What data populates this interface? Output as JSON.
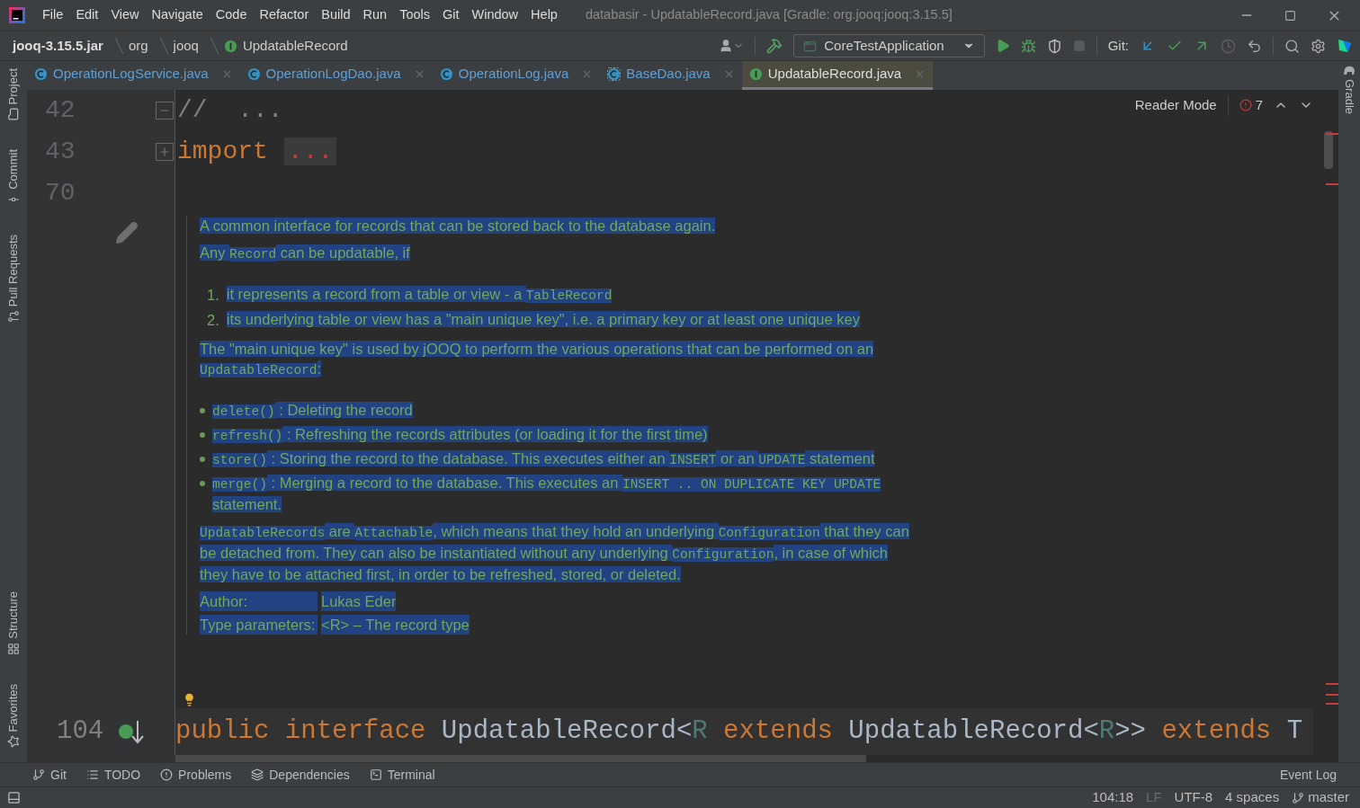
{
  "title_bar": {
    "menu": [
      "File",
      "Edit",
      "View",
      "Navigate",
      "Code",
      "Refactor",
      "Build",
      "Run",
      "Tools",
      "Git",
      "Window",
      "Help"
    ],
    "title": "databasir - UpdatableRecord.java [Gradle: org.jooq:jooq:3.15.5]"
  },
  "breadcrumbs": [
    {
      "label": "jooq-3.15.5.jar",
      "kind": "jar"
    },
    {
      "label": "org",
      "kind": "package"
    },
    {
      "label": "jooq",
      "kind": "package"
    },
    {
      "label": "UpdatableRecord",
      "kind": "interface"
    }
  ],
  "toolbar": {
    "run_configuration": "CoreTestApplication",
    "git_label": "Git:"
  },
  "tabs": [
    {
      "label": "OperationLogService.java",
      "kind": "class",
      "selected": false
    },
    {
      "label": "OperationLogDao.java",
      "kind": "class",
      "selected": false
    },
    {
      "label": "OperationLog.java",
      "kind": "class",
      "selected": false
    },
    {
      "label": "BaseDao.java",
      "kind": "abstract",
      "selected": false
    },
    {
      "label": "UpdatableRecord.java",
      "kind": "interface",
      "selected": true
    }
  ],
  "left_tool_windows": {
    "top": [
      {
        "label": "Project",
        "kind": "folder"
      },
      {
        "label": "Commit",
        "kind": "commit"
      },
      {
        "label": "Pull Requests",
        "kind": "pull"
      }
    ],
    "bottom": [
      {
        "label": "Structure",
        "kind": "structure"
      },
      {
        "label": "Favorites",
        "kind": "star"
      }
    ]
  },
  "right_tool_windows": [
    {
      "label": "Gradle"
    }
  ],
  "editor": {
    "reader_mode": "Reader Mode",
    "problems": "7",
    "lines": [
      {
        "number": "42",
        "expanded": true,
        "tokens": [
          {
            "kind": "comment",
            "text": "//  ..."
          }
        ]
      },
      {
        "number": "43",
        "expanded": false,
        "tokens": [
          {
            "kind": "keyword",
            "text": "import"
          },
          {
            "kind": "folded",
            "text": "..."
          }
        ]
      },
      {
        "number": "70"
      }
    ],
    "doc": [
      {
        "kind": "paragraph",
        "parts": [
          {
            "kind": "text",
            "text": "A common interface for records that can be stored back to the database again."
          }
        ]
      },
      {
        "kind": "paragraph",
        "parts": [
          {
            "kind": "text",
            "text": "Any "
          },
          {
            "kind": "code",
            "text": "Record"
          },
          {
            "kind": "text",
            "text": " can be updatable, if"
          }
        ]
      },
      {
        "kind": "ordered_list",
        "items": [
          {
            "marker": "1.",
            "parts": [
              {
                "kind": "text",
                "text": "it represents a record from a table or view - a "
              },
              {
                "kind": "code",
                "text": "TableRecord"
              }
            ]
          },
          {
            "marker": "2.",
            "parts": [
              {
                "kind": "text",
                "text": "its underlying table or view has a \"main unique key\", i.e. a primary key or at least one unique key"
              }
            ]
          }
        ]
      },
      {
        "kind": "paragraph",
        "parts": [
          {
            "kind": "text",
            "text": "The \"main unique key\" is used by jOOQ to perform the various operations that can be performed on an "
          },
          {
            "kind": "code",
            "text": "UpdatableRecord"
          },
          {
            "kind": "text",
            "text": ":"
          }
        ]
      },
      {
        "kind": "bullet_list",
        "items": [
          {
            "parts": [
              {
                "kind": "code",
                "text": "delete()"
              },
              {
                "kind": "text",
                "text": " : Deleting the record"
              }
            ]
          },
          {
            "parts": [
              {
                "kind": "code",
                "text": "refresh()"
              },
              {
                "kind": "text",
                "text": " : Refreshing the records attributes (or loading it for the first time)"
              }
            ]
          },
          {
            "parts": [
              {
                "kind": "code",
                "text": "store()"
              },
              {
                "kind": "text",
                "text": " : Storing the record to the database. This executes either an "
              },
              {
                "kind": "code",
                "text": "INSERT"
              },
              {
                "kind": "text",
                "text": " or an "
              },
              {
                "kind": "code",
                "text": "UPDATE"
              },
              {
                "kind": "text",
                "text": " statement"
              }
            ]
          },
          {
            "parts": [
              {
                "kind": "code",
                "text": "merge()"
              },
              {
                "kind": "text",
                "text": " : Merging a record to the database. This executes an "
              },
              {
                "kind": "code",
                "text": "INSERT .. ON DUPLICATE KEY UPDATE"
              },
              {
                "kind": "text",
                "text": " statement."
              }
            ]
          }
        ]
      },
      {
        "kind": "paragraph",
        "parts": [
          {
            "kind": "code",
            "text": "UpdatableRecords"
          },
          {
            "kind": "text",
            "text": " are "
          },
          {
            "kind": "code",
            "text": "Attachable"
          },
          {
            "kind": "text",
            "text": ", which means that they hold an underlying "
          },
          {
            "kind": "code",
            "text": "Configuration"
          },
          {
            "kind": "text",
            "text": " that they can be detached from. They can also be instantiated without any underlying "
          },
          {
            "kind": "code",
            "text": "Configuration"
          },
          {
            "kind": "text",
            "text": ", in case of which they have to be attached first, in order to be refreshed, stored, or deleted."
          }
        ]
      },
      {
        "kind": "tags",
        "rows": [
          {
            "label": "Author:",
            "value": "Lukas Eder"
          },
          {
            "label": "Type parameters:",
            "value": "<R> – The record type"
          }
        ]
      }
    ],
    "declaration": {
      "number": "104",
      "tokens": [
        {
          "kind": "keyword",
          "text": "public interface "
        },
        {
          "kind": "plain",
          "text": "UpdatableRecord<"
        },
        {
          "kind": "type_param",
          "text": "R"
        },
        {
          "kind": "keyword",
          "text": " extends "
        },
        {
          "kind": "plain",
          "text": "UpdatableRecord<"
        },
        {
          "kind": "type_param",
          "text": "R"
        },
        {
          "kind": "plain",
          "text": ">> "
        },
        {
          "kind": "keyword",
          "text": "extends "
        },
        {
          "kind": "plain",
          "text": "T"
        }
      ]
    }
  },
  "bottom_tools": [
    {
      "label": "Git",
      "kind": "branch"
    },
    {
      "label": "TODO",
      "kind": "list"
    },
    {
      "label": "Problems",
      "kind": "alert"
    },
    {
      "label": "Dependencies",
      "kind": "layers"
    },
    {
      "label": "Terminal",
      "kind": "terminal"
    }
  ],
  "event_log": "Event Log",
  "status_bar": {
    "position": "104:18",
    "line_separator": "LF",
    "encoding": "UTF-8",
    "indent": "4 spaces",
    "branch": "master"
  }
}
